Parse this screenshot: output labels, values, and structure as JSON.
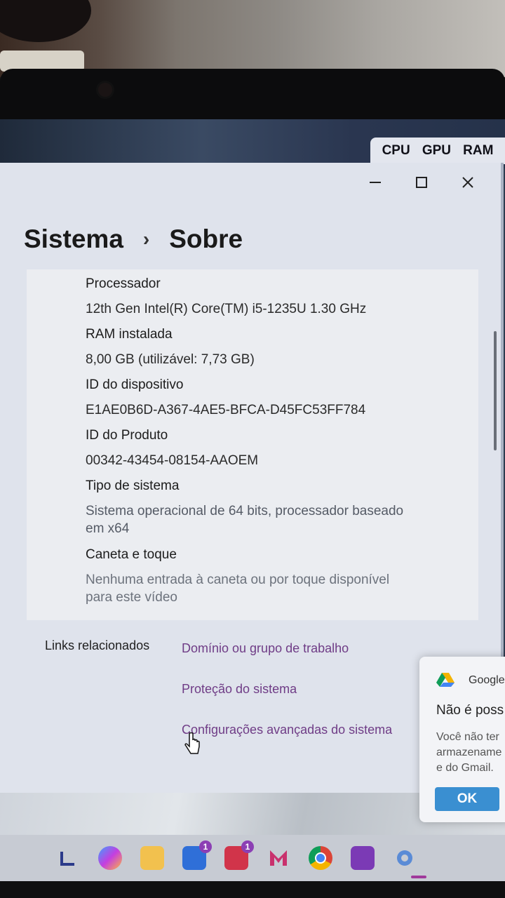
{
  "performance_widget": {
    "cpu": "CPU",
    "gpu": "GPU",
    "ram": "RAM"
  },
  "breadcrumb": {
    "parent": "Sistema",
    "separator": "›",
    "current": "Sobre"
  },
  "window_controls": {
    "minimize": "—",
    "maximize": "☐",
    "close": "✕"
  },
  "specs": [
    {
      "label": "Processador",
      "value": "12th Gen Intel(R) Core(TM) i5-1235U   1.30 GHz"
    },
    {
      "label": "RAM instalada",
      "value": "8,00 GB (utilizável: 7,73 GB)"
    },
    {
      "label": "ID do dispositivo",
      "value": "E1AE0B6D-A367-4AE5-BFCA-D45FC53FF784"
    },
    {
      "label": "ID do Produto",
      "value": "00342-43454-08154-AAOEM"
    },
    {
      "label": "Tipo de sistema",
      "value_line1": "Sistema operacional de 64 bits, processador baseado",
      "value_line2": "em x64"
    },
    {
      "label": "Caneta e toque",
      "value_line1": "Nenhuma entrada à caneta ou por toque disponível",
      "value_line2": "para este vídeo"
    }
  ],
  "related_links": {
    "title": "Links relacionados",
    "items": [
      "Domínio ou grupo de trabalho",
      "Proteção do sistema",
      "Configurações avançadas do sistema"
    ]
  },
  "notification": {
    "app": "Google",
    "title": "Não é poss",
    "body_lines": [
      "Você não ter",
      "armazename",
      "e do Gmail."
    ],
    "ok_label": "OK"
  },
  "taskbar": {
    "icons": [
      "launcher-icon",
      "copilot-icon",
      "file-explorer-icon",
      "app-badge-icon",
      "lexi-icon",
      "malwarebytes-icon",
      "chrome-icon",
      "onenote-icon",
      "settings-icon"
    ],
    "badges": {
      "app_badge": "1",
      "lexi": "1"
    }
  },
  "colors": {
    "link": "#6f3c86",
    "window_bg": "#dfe3ec",
    "ok_button": "#3a8fd1"
  }
}
